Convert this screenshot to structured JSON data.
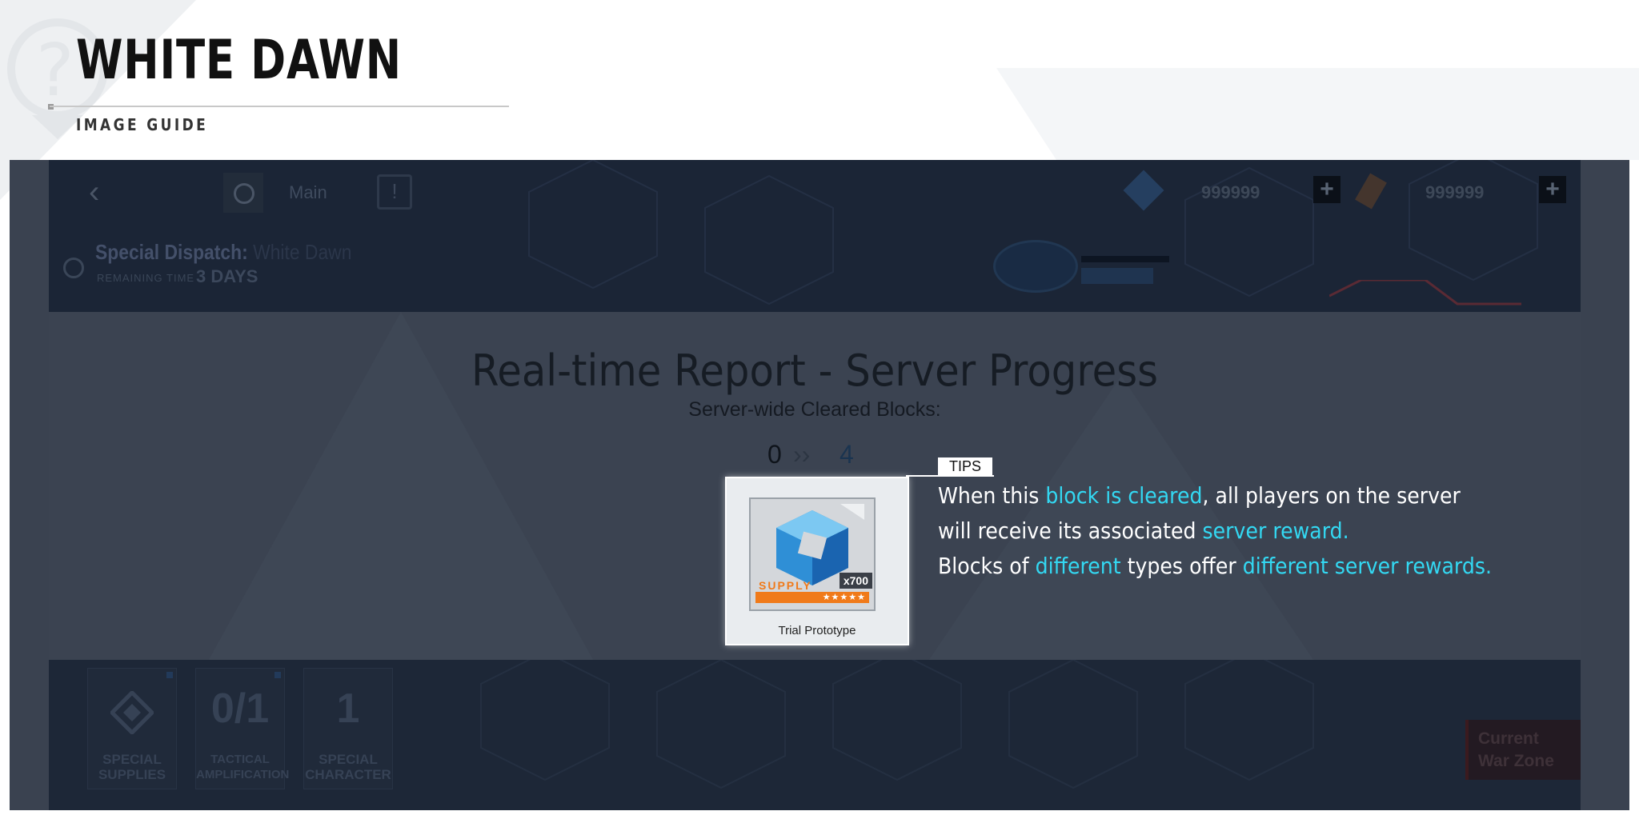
{
  "header": {
    "title": "WHITE DAWN",
    "subtitle": "IMAGE GUIDE"
  },
  "game": {
    "nav": {
      "main_label": "Main",
      "resource1_value": "999999",
      "resource2_value": "999999"
    },
    "event": {
      "title_prefix": "Special Dispatch:",
      "title_name": "White Dawn",
      "remaining_label": "REMAINING TIME",
      "remaining_value": "3 DAYS"
    },
    "report": {
      "title": "Real-time Report - Server Progress",
      "cleared_label": "Server-wide Cleared Blocks:",
      "current": "0",
      "total": "4"
    },
    "bottom": {
      "cards": [
        {
          "glyph": "",
          "label_line1": "SPECIAL",
          "label_line2": "SUPPLIES"
        },
        {
          "glyph": "0/1",
          "label_line1": "TACTICAL",
          "label_line2": "AMPLIFICATION"
        },
        {
          "glyph": "1",
          "label_line1": "SPECIAL",
          "label_line2": "CHARACTER"
        }
      ],
      "zone_line1": "Current",
      "zone_line2": "War Zone"
    }
  },
  "tips": {
    "tag": "TIPS",
    "item_name": "Trial Prototype",
    "item_qty": "x700",
    "item_brand": "SUPPLY",
    "item_stars": "★★★★★",
    "line1": {
      "a": "When this ",
      "b": "block is cleared",
      "c": ", all players on the server"
    },
    "line2": {
      "a": "will receive its associated ",
      "b": "server reward."
    },
    "line3": {
      "a": "Blocks of ",
      "b": "different",
      "c": " types offer ",
      "d": "different server rewards."
    },
    "highlight_color": "#33d8f2"
  }
}
